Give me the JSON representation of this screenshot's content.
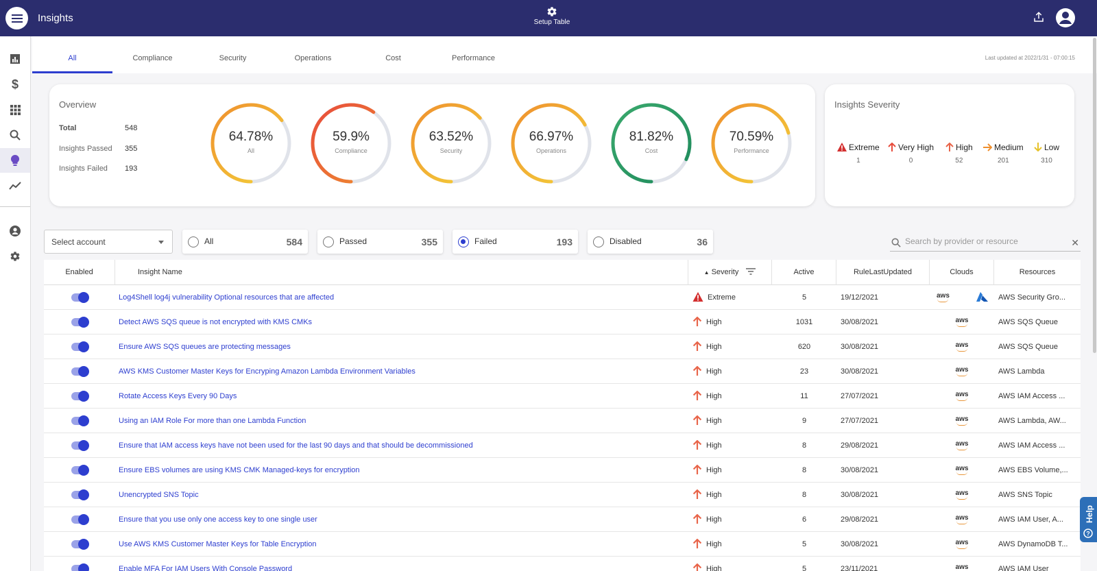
{
  "header": {
    "title": "Insights",
    "setup_label": "Setup Table"
  },
  "tabs": [
    {
      "label": "All",
      "active": true
    },
    {
      "label": "Compliance"
    },
    {
      "label": "Security"
    },
    {
      "label": "Operations"
    },
    {
      "label": "Cost"
    },
    {
      "label": "Performance"
    }
  ],
  "last_updated": "Last updated at 2022/1/31 - 07:00:15",
  "overview": {
    "title": "Overview",
    "total_label": "Total",
    "total": "548",
    "passed_label": "Insights Passed",
    "passed": "355",
    "failed_label": "Insights Failed",
    "failed": "193",
    "rings": [
      {
        "pct": "64.78%",
        "label": "All",
        "value": 64.78,
        "color": "#ef8f2e",
        "color2": "#f4d43a"
      },
      {
        "pct": "59.9%",
        "label": "Compliance",
        "value": 59.9,
        "color": "#e84b3c",
        "color2": "#ef8f2e"
      },
      {
        "pct": "63.52%",
        "label": "Security",
        "value": 63.52,
        "color": "#ef8f2e",
        "color2": "#f4d43a"
      },
      {
        "pct": "66.97%",
        "label": "Operations",
        "value": 66.97,
        "color": "#ef8f2e",
        "color2": "#f4d43a"
      },
      {
        "pct": "81.82%",
        "label": "Cost",
        "value": 81.82,
        "color": "#3aa96d",
        "color2": "#1e8a5c"
      },
      {
        "pct": "70.59%",
        "label": "Performance",
        "value": 70.59,
        "color": "#ef8f2e",
        "color2": "#f4d43a"
      }
    ]
  },
  "severity_card": {
    "title": "Insights Severity",
    "items": [
      {
        "label": "Extreme",
        "count": "1",
        "icon": "warning-triangle-icon",
        "color": "#d32f2f"
      },
      {
        "label": "Very High",
        "count": "0",
        "icon": "arrow-up-icon",
        "color": "#e74c3c"
      },
      {
        "label": "High",
        "count": "52",
        "icon": "arrow-up-icon",
        "color": "#e8654a"
      },
      {
        "label": "Medium",
        "count": "201",
        "icon": "arrow-right-icon",
        "color": "#ef8f2e"
      },
      {
        "label": "Low",
        "count": "310",
        "icon": "arrow-down-icon",
        "color": "#e6c22a"
      }
    ]
  },
  "filters": {
    "account_placeholder": "Select account",
    "options": [
      {
        "label": "All",
        "count": "584",
        "selected": false
      },
      {
        "label": "Passed",
        "count": "355",
        "selected": false
      },
      {
        "label": "Failed",
        "count": "193",
        "selected": true
      },
      {
        "label": "Disabled",
        "count": "36",
        "selected": false
      }
    ],
    "search_placeholder": "Search by provider or resource"
  },
  "table": {
    "columns": [
      "Enabled",
      "Insight Name",
      "Severity",
      "Active",
      "RuleLastUpdated",
      "Clouds",
      "Resources"
    ],
    "rows": [
      {
        "name": "Log4Shell log4j vulnerability Optional resources that are affected",
        "severity": "Extreme",
        "active": "5",
        "updated": "19/12/2021",
        "clouds": [
          "aws",
          "azure"
        ],
        "resources": "AWS Security Gro..."
      },
      {
        "name": "Detect AWS SQS queue is not encrypted with KMS CMKs",
        "severity": "High",
        "active": "1031",
        "updated": "30/08/2021",
        "clouds": [
          "aws"
        ],
        "resources": "AWS SQS Queue"
      },
      {
        "name": "Ensure AWS SQS queues are protecting messages",
        "severity": "High",
        "active": "620",
        "updated": "30/08/2021",
        "clouds": [
          "aws"
        ],
        "resources": "AWS SQS Queue"
      },
      {
        "name": "AWS KMS Customer Master Keys for Encryping Amazon Lambda Environment Variables",
        "severity": "High",
        "active": "23",
        "updated": "30/08/2021",
        "clouds": [
          "aws"
        ],
        "resources": "AWS Lambda"
      },
      {
        "name": "Rotate Access Keys Every 90 Days",
        "severity": "High",
        "active": "11",
        "updated": "27/07/2021",
        "clouds": [
          "aws"
        ],
        "resources": "AWS IAM Access ..."
      },
      {
        "name": "Using an IAM Role For more than one Lambda Function",
        "severity": "High",
        "active": "9",
        "updated": "27/07/2021",
        "clouds": [
          "aws"
        ],
        "resources": "AWS Lambda, AW..."
      },
      {
        "name": "Ensure that IAM access keys have not been used for the last 90 days and that should be decommissioned",
        "severity": "High",
        "active": "8",
        "updated": "29/08/2021",
        "clouds": [
          "aws"
        ],
        "resources": "AWS IAM Access ..."
      },
      {
        "name": "Ensure EBS volumes are using KMS CMK Managed-keys for encryption",
        "severity": "High",
        "active": "8",
        "updated": "30/08/2021",
        "clouds": [
          "aws"
        ],
        "resources": "AWS EBS Volume,..."
      },
      {
        "name": "Unencrypted SNS Topic",
        "severity": "High",
        "active": "8",
        "updated": "30/08/2021",
        "clouds": [
          "aws"
        ],
        "resources": "AWS SNS Topic"
      },
      {
        "name": "Ensure that you use only one access key to one single user",
        "severity": "High",
        "active": "6",
        "updated": "29/08/2021",
        "clouds": [
          "aws"
        ],
        "resources": "AWS IAM User, A..."
      },
      {
        "name": "Use AWS KMS Customer Master Keys for Table Encryption",
        "severity": "High",
        "active": "5",
        "updated": "30/08/2021",
        "clouds": [
          "aws"
        ],
        "resources": "AWS DynamoDB T..."
      },
      {
        "name": "Enable MFA For IAM Users With Console Password",
        "severity": "High",
        "active": "5",
        "updated": "23/11/2021",
        "clouds": [
          "aws"
        ],
        "resources": "AWS IAM User"
      }
    ]
  },
  "help_label": "Help"
}
